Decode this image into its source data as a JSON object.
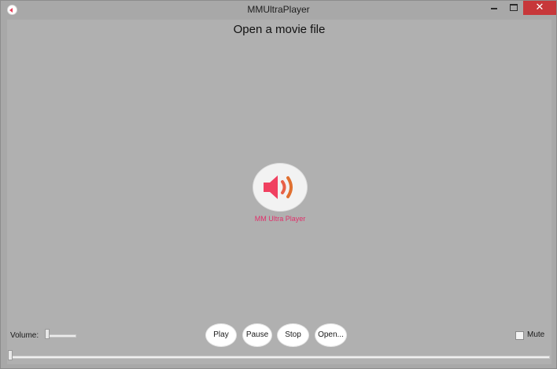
{
  "window": {
    "title": "MMUltraPlayer",
    "close_glyph": "✕",
    "icons": [
      "app-icon",
      "minimize-icon",
      "maximize-icon",
      "close-icon"
    ]
  },
  "main": {
    "heading": "Open a movie file",
    "logo_caption": "MM Ultra Player",
    "logo_icon": "speaker-icon"
  },
  "controls": {
    "volume_label": "Volume:",
    "volume_level": 0.1,
    "play_label": "Play",
    "pause_label": "Pause",
    "stop_label": "Stop",
    "open_label": "Open...",
    "mute_label": "Mute",
    "mute_checked": false,
    "seek_position": 0
  },
  "colors": {
    "background": "#b0b0b0",
    "close_button": "#c7373a",
    "accent_pink": "#e0306a",
    "speaker_red": "#f04060",
    "wave_orange": "#e07030"
  }
}
